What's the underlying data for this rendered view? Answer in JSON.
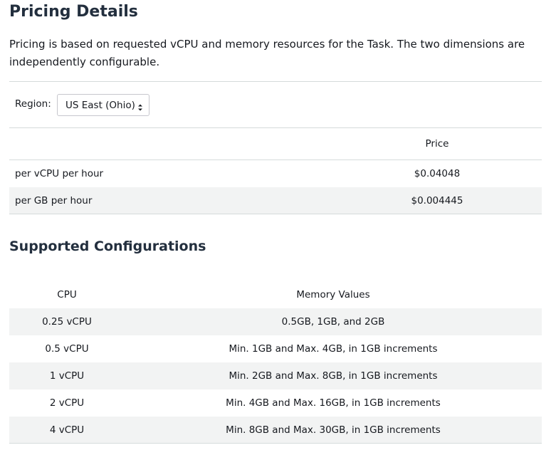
{
  "pricing": {
    "title": "Pricing Details",
    "description": "Pricing is based on requested vCPU and memory resources for the Task. The two dimensions are independently configurable.",
    "region_label": "Region:",
    "region_selected": "US East (Ohio)",
    "table": {
      "header_price": "Price",
      "rows": [
        {
          "label": "per vCPU per hour",
          "price": "$0.04048"
        },
        {
          "label": "per GB per hour",
          "price": "$0.004445"
        }
      ]
    }
  },
  "configurations": {
    "title": "Supported Configurations",
    "header_cpu": "CPU",
    "header_memory": "Memory Values",
    "rows": [
      {
        "cpu": "0.25 vCPU",
        "memory": "0.5GB, 1GB, and 2GB"
      },
      {
        "cpu": "0.5 vCPU",
        "memory": "Min. 1GB and Max. 4GB, in 1GB increments"
      },
      {
        "cpu": "1 vCPU",
        "memory": "Min. 2GB and Max. 8GB, in 1GB increments"
      },
      {
        "cpu": "2 vCPU",
        "memory": "Min. 4GB and Max. 16GB, in 1GB increments"
      },
      {
        "cpu": "4 vCPU",
        "memory": "Min. 8GB and Max. 30GB, in 1GB increments"
      }
    ]
  },
  "icons": {
    "region_select": "select-arrows-icon"
  },
  "colors": {
    "heading": "#232f3e",
    "text": "#16191f",
    "divider": "#d5dbdb",
    "row_shade": "#f2f3f3"
  }
}
